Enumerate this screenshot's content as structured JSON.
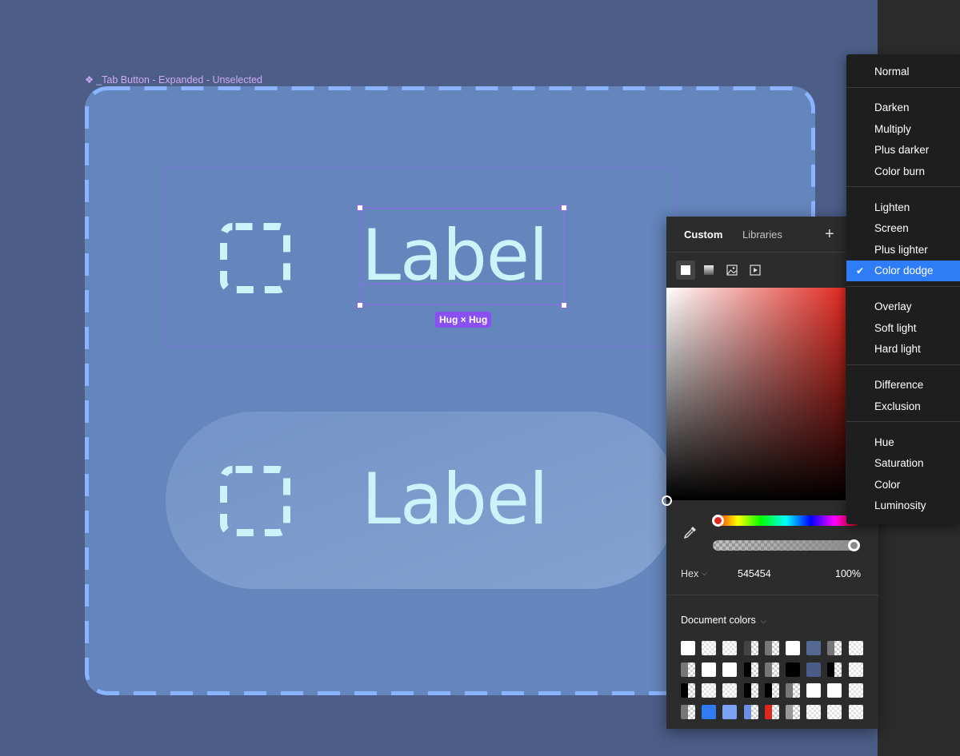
{
  "canvas": {
    "component_label": "_Tab Button - Expanded - Unselected",
    "component_icon": "component-diamond-icon",
    "tab_top": {
      "label": "Label",
      "icon": "dashed-square-icon",
      "size_badge": "Hug × Hug"
    },
    "tab_bottom": {
      "label": "Label",
      "icon": "dashed-square-icon"
    },
    "colors": {
      "background": "#4c5e88",
      "component_fill": "#6585bd",
      "dash_stroke": "#8ab4ff",
      "label_text": "#cdf3fa",
      "selection": "#8f6cf1"
    }
  },
  "color_picker": {
    "tabs": [
      {
        "label": "Custom",
        "active": true
      },
      {
        "label": "Libraries",
        "active": false
      }
    ],
    "add_icon": "plus-icon",
    "fill_types": [
      "solid-fill-icon",
      "gradient-fill-icon",
      "image-fill-icon",
      "video-fill-icon"
    ],
    "selected_hue": "#e0281f",
    "format": "Hex",
    "hex_value": "545454",
    "opacity": "100%",
    "document_colors_label": "Document colors",
    "swatches": [
      [
        "#ffffff",
        "checker",
        "checker",
        "half:#444444",
        "half:#777777",
        "#ffffff",
        "#546991",
        "half:#777777",
        "checker"
      ],
      [
        "half:#777777",
        "#ffffff",
        "#ffffff",
        "half:#000000",
        "half:#777777",
        "#000000",
        "#4a5d89",
        "half:#000000",
        "checker"
      ],
      [
        "half:#000000",
        "checker",
        "checker",
        "half:#000000",
        "half:#000000",
        "half:#777777",
        "#ffffff",
        "#ffffff",
        "checker"
      ],
      [
        "half:#777777",
        "#2f7df6",
        "#7aa3f5",
        "half:#6c8fe8",
        "half:#e0281f",
        "half:#999999",
        "checker",
        "checker",
        "checker"
      ]
    ]
  },
  "blend_menu": {
    "groups": [
      [
        "Normal"
      ],
      [
        "Darken",
        "Multiply",
        "Plus darker",
        "Color burn"
      ],
      [
        "Lighten",
        "Screen",
        "Plus lighter",
        "Color dodge"
      ],
      [
        "Overlay",
        "Soft light",
        "Hard light"
      ],
      [
        "Difference",
        "Exclusion"
      ],
      [
        "Hue",
        "Saturation",
        "Color",
        "Luminosity"
      ]
    ],
    "selected": "Color dodge",
    "selected_color": "#2f7df6"
  }
}
